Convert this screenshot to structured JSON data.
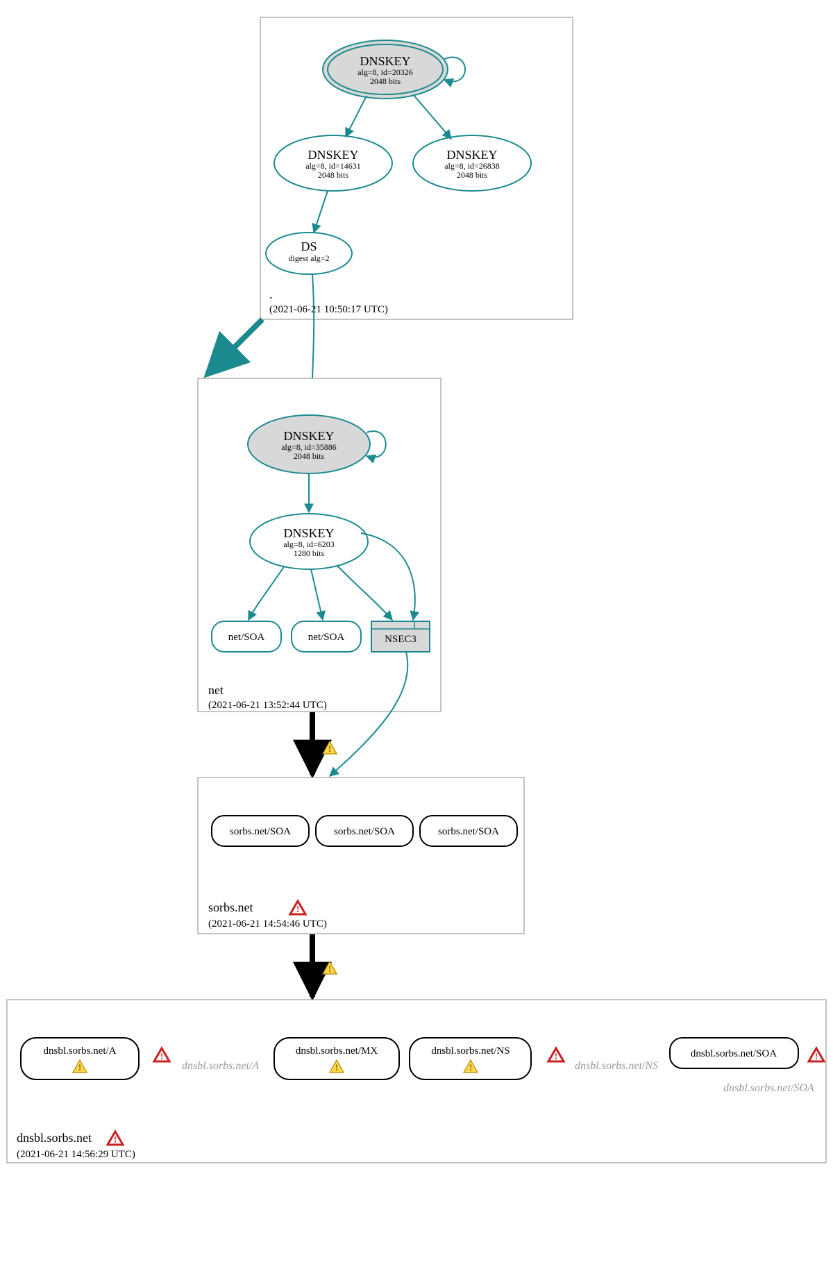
{
  "zones": {
    "root": {
      "name": ".",
      "timestamp": "(2021-06-21 10:50:17 UTC)",
      "nodes": {
        "ksk": {
          "title": "DNSKEY",
          "line1": "alg=8, id=20326",
          "line2": "2048 bits"
        },
        "zsk1": {
          "title": "DNSKEY",
          "line1": "alg=8, id=14631",
          "line2": "2048 bits"
        },
        "zsk2": {
          "title": "DNSKEY",
          "line1": "alg=8, id=26838",
          "line2": "2048 bits"
        },
        "ds": {
          "title": "DS",
          "line1": "digest alg=2"
        }
      }
    },
    "net": {
      "name": "net",
      "timestamp": "(2021-06-21 13:52:44 UTC)",
      "nodes": {
        "ksk": {
          "title": "DNSKEY",
          "line1": "alg=8, id=35886",
          "line2": "2048 bits"
        },
        "zsk": {
          "title": "DNSKEY",
          "line1": "alg=8, id=6203",
          "line2": "1280 bits"
        },
        "soa1": {
          "title": "net/SOA"
        },
        "soa2": {
          "title": "net/SOA"
        },
        "nsec": {
          "title": "NSEC3"
        }
      }
    },
    "sorbs": {
      "name": "sorbs.net",
      "timestamp": "(2021-06-21 14:54:46 UTC)",
      "nodes": {
        "soa1": {
          "title": "sorbs.net/SOA"
        },
        "soa2": {
          "title": "sorbs.net/SOA"
        },
        "soa3": {
          "title": "sorbs.net/SOA"
        }
      }
    },
    "dnsbl": {
      "name": "dnsbl.sorbs.net",
      "timestamp": "(2021-06-21 14:56:29 UTC)",
      "nodes": {
        "a": {
          "title": "dnsbl.sorbs.net/A"
        },
        "mx": {
          "title": "dnsbl.sorbs.net/MX"
        },
        "ns": {
          "title": "dnsbl.sorbs.net/NS"
        },
        "soa": {
          "title": "dnsbl.sorbs.net/SOA"
        }
      },
      "faded": {
        "a": "dnsbl.sorbs.net/A",
        "ns": "dnsbl.sorbs.net/NS",
        "soa": "dnsbl.sorbs.net/SOA"
      }
    }
  },
  "colors": {
    "teal": "#1b8a8f",
    "grey_fill": "#d8d8d8",
    "box_stroke": "#888888",
    "black": "#000000"
  }
}
